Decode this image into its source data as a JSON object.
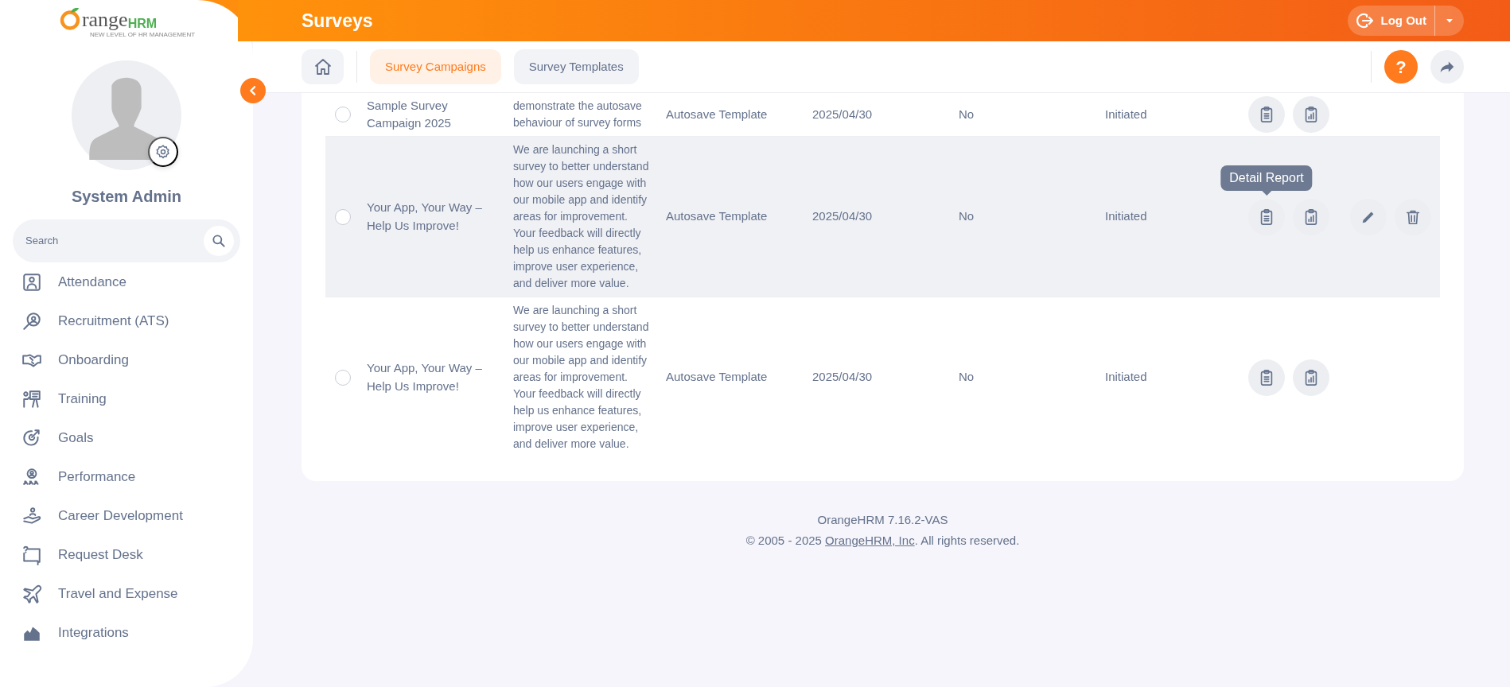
{
  "sidebar": {
    "logo": {
      "brand_main": "range",
      "brand_suffix": "HRM",
      "tagline": "NEW LEVEL OF HR MANAGEMENT"
    },
    "user_name": "System Admin",
    "search": {
      "placeholder": "Search"
    },
    "items": [
      {
        "label": "Attendance"
      },
      {
        "label": "Recruitment (ATS)"
      },
      {
        "label": "Onboarding"
      },
      {
        "label": "Training"
      },
      {
        "label": "Goals"
      },
      {
        "label": "Performance"
      },
      {
        "label": "Career Development"
      },
      {
        "label": "Request Desk"
      },
      {
        "label": "Travel and Expense"
      },
      {
        "label": "Integrations"
      }
    ]
  },
  "header": {
    "title": "Surveys",
    "logout": "Log Out"
  },
  "tabs": [
    {
      "label": "Survey Campaigns",
      "selected": true
    },
    {
      "label": "Survey Templates",
      "selected": false
    }
  ],
  "help": "?",
  "table": {
    "rows": [
      {
        "checked": false,
        "hovered": false,
        "name": "Sample Survey Campaign 2025",
        "description": "demonstrate the autosave behaviour of survey forms",
        "template": "Autosave Template",
        "date": "2025/04/30",
        "column_5": "No",
        "status": "Initiated",
        "actions": [
          {
            "kind": "detail"
          },
          {
            "kind": "summary"
          }
        ]
      },
      {
        "checked": false,
        "hovered": true,
        "name": "Your App, Your Way – Help Us Improve!",
        "description": "We are launching a short survey to better understand how our users engage with our mobile app and identify areas for improvement. Your feedback will directly help us enhance features, improve user experience, and deliver more value.",
        "template": "Autosave Template",
        "date": "2025/04/30",
        "column_5": "No",
        "status": "Initiated",
        "actions": [
          {
            "kind": "detail",
            "tooltip": "Detail Report"
          },
          {
            "kind": "summary"
          },
          {
            "kind": "edit"
          },
          {
            "kind": "delete"
          }
        ]
      },
      {
        "checked": false,
        "hovered": false,
        "name": "Your App, Your Way – Help Us Improve!",
        "description": "We are launching a short survey to better understand how our users engage with our mobile app and identify areas for improvement. Your feedback will directly help us enhance features, improve user experience, and deliver more value.",
        "template": "Autosave Template",
        "date": "2025/04/30",
        "column_5": "No",
        "status": "Initiated",
        "actions": [
          {
            "kind": "detail"
          },
          {
            "kind": "summary"
          }
        ]
      }
    ]
  },
  "footer": {
    "version": "OrangeHRM 7.16.2-VAS",
    "copyright_before": "© 2005 - 2025",
    "link": "OrangeHRM, Inc",
    "copyright_after": ". All rights reserved."
  }
}
